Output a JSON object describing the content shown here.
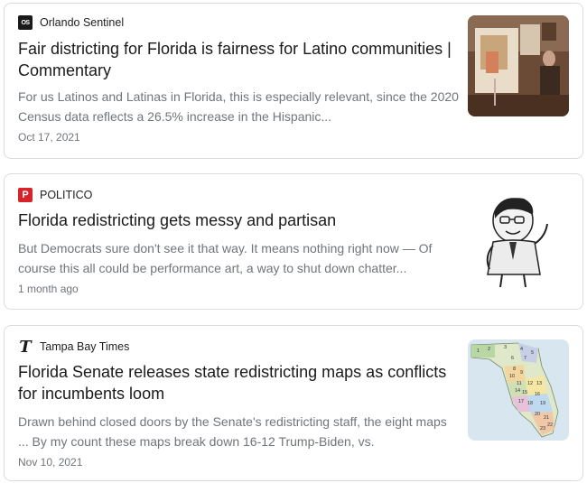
{
  "results": [
    {
      "source": "Orlando Sentinel",
      "logo_text": "OS",
      "title": "Fair districting for Florida is fairness for Latino communities | Commentary",
      "snippet": "For us Latinos and Latinas in Florida, this is especially relevant, since the 2020 Census data reflects a 26.5% increase in the Hispanic...",
      "date": "Oct 17, 2021",
      "thumb_icon": "presentation-photo-icon"
    },
    {
      "source": "POLITICO",
      "logo_text": "P",
      "title": "Florida redistricting gets messy and partisan",
      "snippet": "But Democrats sure don't see it that way. It means nothing right now — Of course this all could be performance art, a way to shut down chatter...",
      "date": "1 month ago",
      "thumb_icon": "caricature-icon"
    },
    {
      "source": "Tampa Bay Times",
      "logo_text": "T",
      "title": "Florida Senate releases state redistricting maps as conflicts for incumbents loom",
      "snippet": "Drawn behind closed doors by the Senate's redistricting staff, the eight maps ... By my count these maps break down 16-12 Trump-Biden, vs.",
      "date": "Nov 10, 2021",
      "thumb_icon": "florida-map-icon",
      "map_labels": [
        "1",
        "2",
        "3",
        "4",
        "5",
        "6",
        "7",
        "8",
        "9",
        "10",
        "11",
        "12",
        "13",
        "14",
        "15",
        "16",
        "17",
        "18",
        "19",
        "20",
        "21",
        "22",
        "23"
      ]
    }
  ],
  "colors": {
    "title": "#1a1a1a",
    "meta": "#70757a",
    "border": "#dadce0",
    "politico": "#d8232a"
  }
}
